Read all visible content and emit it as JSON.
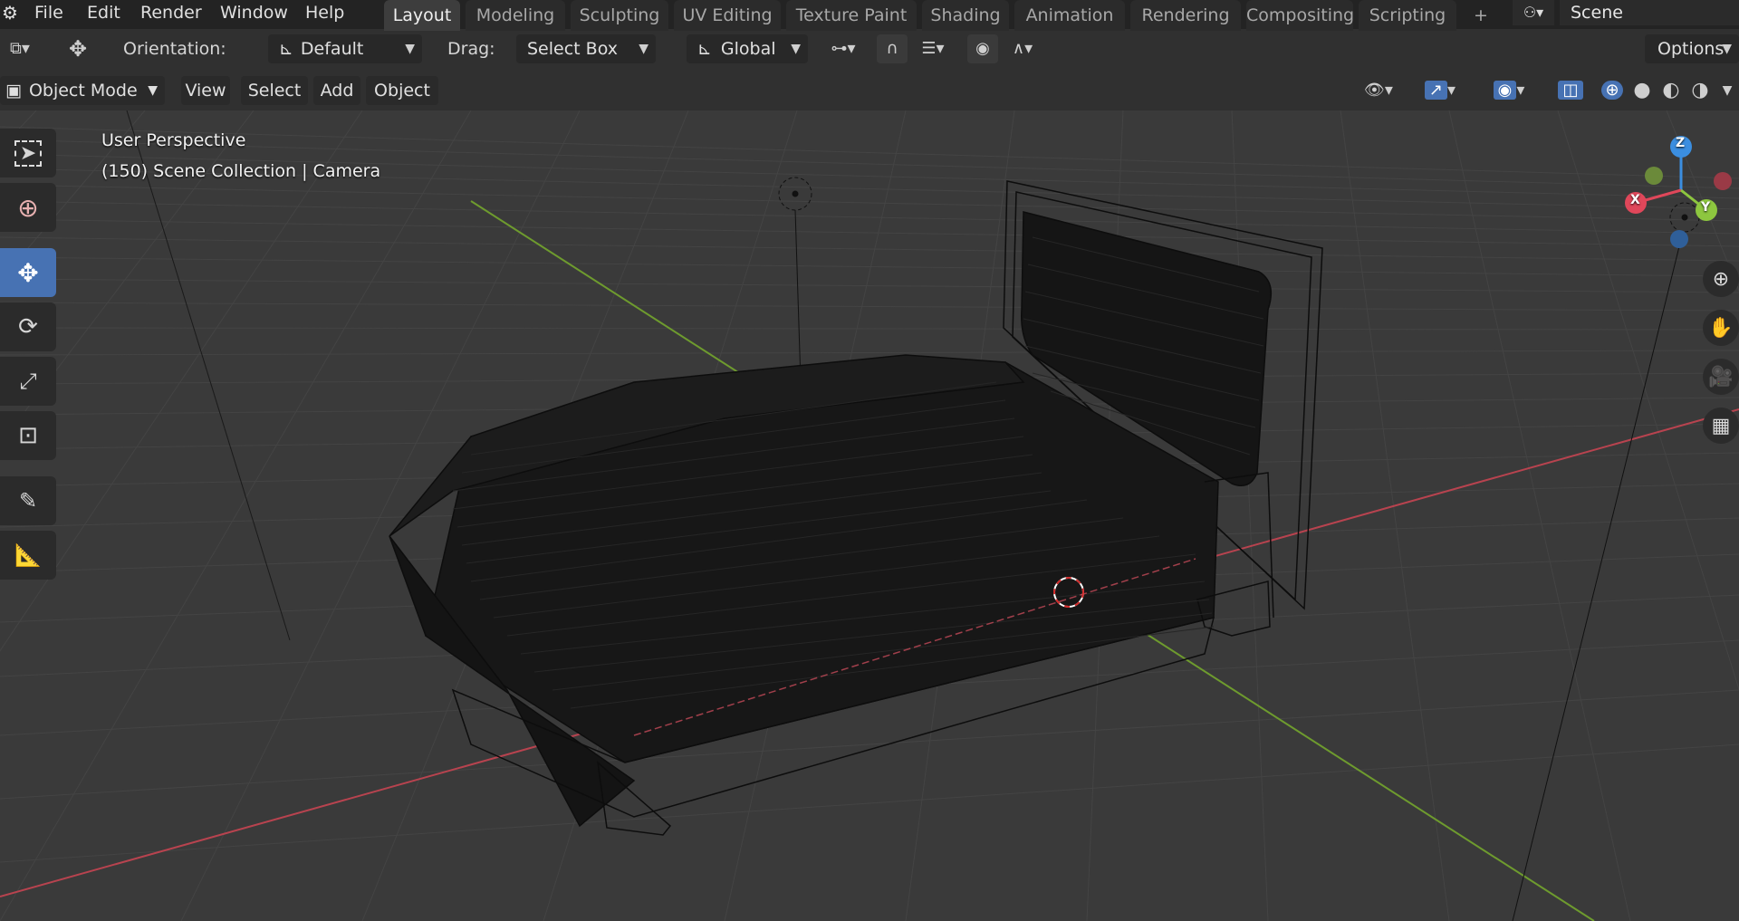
{
  "app": {
    "menus": [
      "File",
      "Edit",
      "Render",
      "Window",
      "Help"
    ],
    "workspace_tabs": [
      "Layout",
      "Modeling",
      "Sculpting",
      "UV Editing",
      "Texture Paint",
      "Shading",
      "Animation",
      "Rendering",
      "Compositing",
      "Scripting"
    ],
    "active_tab": "Layout",
    "add_tab_label": "+",
    "scene_name": "Scene"
  },
  "tool_settings": {
    "orientation_label": "Orientation:",
    "orientation_value": "Default",
    "drag_label": "Drag:",
    "drag_value": "Select Box",
    "transform_orientation": "Global",
    "options_label": "Options"
  },
  "header": {
    "mode": "Object Mode",
    "menus": [
      "View",
      "Select",
      "Add",
      "Object"
    ]
  },
  "viewport": {
    "view_name": "User Perspective",
    "collection_info": "(150) Scene Collection | Camera",
    "gizmo_axes": [
      "Z",
      "X",
      "Y"
    ]
  },
  "colors": {
    "active_blue": "#4772b3",
    "x_axis": "#e0475a",
    "y_axis": "#8dc63f",
    "z_axis": "#3b8ee0",
    "grid": "#454545"
  },
  "icons": {
    "left_tools": [
      "select-box-icon",
      "cursor-icon",
      "move-icon",
      "rotate-icon",
      "scale-icon",
      "transform-icon",
      "annotate-icon",
      "measure-icon"
    ],
    "nav": [
      "zoom-icon",
      "pan-hand-icon",
      "camera-view-icon",
      "ortho-grid-icon"
    ]
  }
}
